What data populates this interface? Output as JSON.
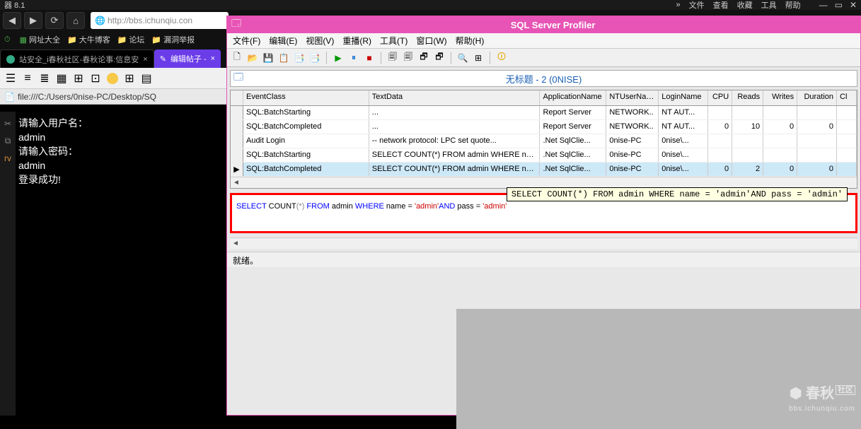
{
  "browser": {
    "title_suffix": "器 8.1",
    "menu_right": [
      "»",
      "文件",
      "查看",
      "收藏",
      "工具",
      "帮助"
    ],
    "url": "http://bbs.ichunqiu.con",
    "bookmarks": [
      {
        "icon": "⏱",
        "label": "",
        "cls": "green-ico"
      },
      {
        "icon": "▦",
        "label": "网址大全",
        "cls": "green-ico"
      },
      {
        "icon": "📁",
        "label": "大牛博客",
        "cls": "folder-ico"
      },
      {
        "icon": "📁",
        "label": "论坛",
        "cls": "folder-ico"
      },
      {
        "icon": "📁",
        "label": "漏洞举报",
        "cls": "folder-ico"
      }
    ],
    "tabs": [
      {
        "label": "站安全_i春秋社区-春秋论事:信息安",
        "active": false
      },
      {
        "label": "编辑帖子 -",
        "active": true
      }
    ],
    "file_strip": "file:///C:/Users/0nise-PC/Desktop/SQ"
  },
  "console": {
    "lines": [
      {
        "t": "请输入用户名：",
        "c": "#fff"
      },
      {
        "t": "admin",
        "c": "#fff"
      },
      {
        "t": "请输入密码：",
        "c": "#fff"
      },
      {
        "t": "admin",
        "c": "#fff"
      },
      {
        "t": "登录成功!",
        "c": "#fff"
      }
    ]
  },
  "profiler": {
    "title": "SQL Server Profiler",
    "menu": [
      "文件(F)",
      "编辑(E)",
      "视图(V)",
      "重播(R)",
      "工具(T)",
      "窗口(W)",
      "帮助(H)"
    ],
    "doc_title": "无标题 - 2 (0NISE)",
    "columns": [
      "",
      "EventClass",
      "TextData",
      "ApplicationName",
      "NTUserName",
      "LoginName",
      "CPU",
      "Reads",
      "Writes",
      "Duration",
      "Cl"
    ],
    "rows": [
      {
        "ev": "SQL:BatchStarting",
        "td": "...",
        "app": "Report Server",
        "nt": "NETWORK..",
        "login": "NT AUT...",
        "cpu": "",
        "reads": "",
        "writes": "",
        "dur": ""
      },
      {
        "ev": "SQL:BatchCompleted",
        "td": "...",
        "app": "Report Server",
        "nt": "NETWORK..",
        "login": "NT AUT...",
        "cpu": "0",
        "reads": "10",
        "writes": "0",
        "dur": "0"
      },
      {
        "ev": "Audit Login",
        "td": "-- network protocol: LPC  set quote...",
        "app": ".Net SqlClie...",
        "nt": "0nise-PC",
        "login": "0nise\\...",
        "cpu": "",
        "reads": "",
        "writes": "",
        "dur": ""
      },
      {
        "ev": "SQL:BatchStarting",
        "td": "SELECT COUNT(*) FROM admin WHERE na...",
        "app": ".Net SqlClie...",
        "nt": "0nise-PC",
        "login": "0nise\\...",
        "cpu": "",
        "reads": "",
        "writes": "",
        "dur": ""
      },
      {
        "ev": "SQL:BatchCompleted",
        "td": "SELECT COUNT(*) FROM admin WHERE na...",
        "app": ".Net SqlClie...",
        "nt": "0nise-PC",
        "login": "0nise\\...",
        "cpu": "0",
        "reads": "2",
        "writes": "0",
        "dur": "0",
        "sel": true
      }
    ],
    "tooltip": "SELECT COUNT(*) FROM admin WHERE name = 'admin'AND pass = 'admin'",
    "detail_parts": [
      {
        "t": "SELECT",
        "c": "kw-blue"
      },
      {
        "t": " COUNT",
        "c": ""
      },
      {
        "t": "(*)",
        "c": "kw-gray"
      },
      {
        "t": " FROM",
        "c": "kw-blue"
      },
      {
        "t": " admin ",
        "c": ""
      },
      {
        "t": "WHERE",
        "c": "kw-blue"
      },
      {
        "t": " name = ",
        "c": ""
      },
      {
        "t": "'admin'",
        "c": "kw-red"
      },
      {
        "t": "AND",
        "c": "kw-blue"
      },
      {
        "t": " pass = ",
        "c": ""
      },
      {
        "t": "'admin'",
        "c": "kw-red"
      }
    ],
    "status": "就绪。"
  },
  "watermark": {
    "main": "⬢ 春秋",
    "sub": "bbs.ichunqiu.com",
    "badge": "社区"
  }
}
